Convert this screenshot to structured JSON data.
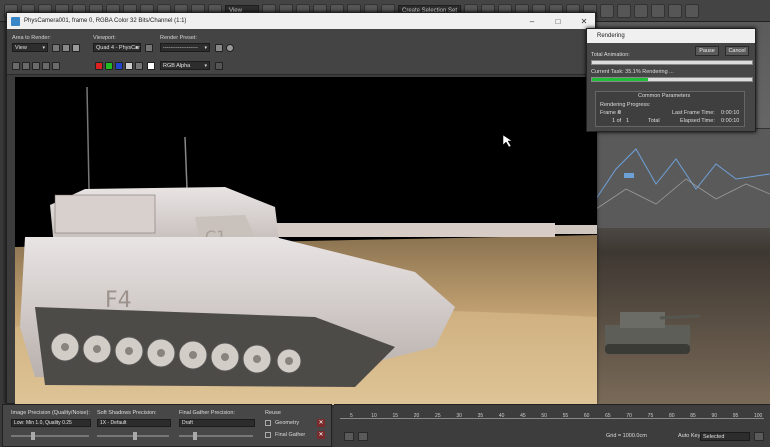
{
  "main_toolbar": {
    "dropdowns": [
      "View",
      "Create Selection Set"
    ]
  },
  "frame_window": {
    "title": "PhysCamera001, frame 0, RGBA Color 32 Bits/Channel (1:1)",
    "area_to_render_label": "Area to Render:",
    "area_to_render_value": "View",
    "viewport_label": "Viewport:",
    "viewport_value": "Quad 4 - PhysCar",
    "render_preset_label": "Render Preset:",
    "render_preset_value": "-------------------",
    "channel_value": "RGB Alpha",
    "minimize_icon": "minimize-icon",
    "maximize_icon": "maximize-icon",
    "close_icon": "close-icon"
  },
  "rendering_dialog": {
    "title": "Rendering",
    "pause_label": "Pause",
    "cancel_label": "Cancel",
    "total_animation_label": "Total Animation:",
    "current_task_label": "Current Task:  35.1%  Rendering ...",
    "progress": 0.351,
    "common_parameters_label": "Common Parameters",
    "rendering_progress_label": "Rendering Progress:",
    "frame_label": "Frame #",
    "frame_value": "0",
    "of_label": "1 of",
    "of_value": "1",
    "total_label": "Total",
    "last_frame_time_label": "Last Frame Time:",
    "last_frame_time_value": "0:00:10",
    "elapsed_time_label": "Elapsed Time:",
    "elapsed_time_value": "0:00:10"
  },
  "bottom_panel": {
    "image_precision_label": "Image Precision (Quality/Noise):",
    "image_precision_value": "Low: Min 1.0, Quality 0.25",
    "soft_shadows_label": "Soft Shadows Precision:",
    "soft_shadows_value": "1X - Default",
    "final_gather_label": "Final Gather Precision:",
    "final_gather_value": "Draft",
    "reuse_label": "Reuse",
    "geometry_label": "Geometry",
    "final_gather_reuse_label": "Final Gather"
  },
  "timeline": {
    "ticks": [
      "5",
      "10",
      "15",
      "20",
      "25",
      "30",
      "35",
      "40",
      "45",
      "50",
      "55",
      "60",
      "65",
      "70",
      "75",
      "80",
      "85",
      "90",
      "95",
      "100"
    ],
    "grid_text": "Grid = 1000.0cm",
    "auto_key_label": "Auto Key",
    "selected_value": "Selected",
    "set_key_label": "Set Key"
  },
  "colors": {
    "progress_fill": "#1fbd3a",
    "title_bar": "#f0f0f0",
    "panel_bg": "#444444"
  }
}
